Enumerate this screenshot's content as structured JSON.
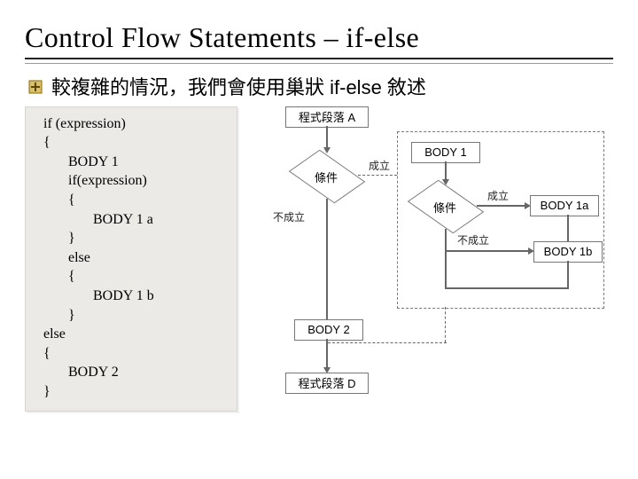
{
  "title": "Control Flow Statements – if-else",
  "bullet": "較複雜的情況，我們會使用巢狀 if-else 敘述",
  "code": {
    "l1": "if (expression)",
    "l2": "{",
    "l3": "BODY 1",
    "l4": "if(expression)",
    "l5": "{",
    "l6": "BODY 1 a",
    "l7": "}",
    "l8": "else",
    "l9": "{",
    "l10": "BODY 1 b",
    "l11": "}",
    "l12": "else",
    "l13": "{",
    "l14": "BODY 2",
    "l15": "}"
  },
  "flowchart": {
    "blockA": "程式段落 A",
    "cond1": "條件",
    "cond2": "條件",
    "trueLabel": "成立",
    "falseLabel": "不成立",
    "body1": "BODY 1",
    "body1a": "BODY 1a",
    "body1b": "BODY 1b",
    "body2": "BODY 2",
    "blockD": "程式段落 D"
  },
  "chart_data": {
    "type": "flowchart",
    "title": "巢狀 if-else 控制流程圖",
    "nodes": [
      {
        "id": "A",
        "kind": "process",
        "label": "程式段落 A"
      },
      {
        "id": "c1",
        "kind": "decision",
        "label": "條件"
      },
      {
        "id": "B1",
        "kind": "process",
        "label": "BODY 1"
      },
      {
        "id": "c2",
        "kind": "decision",
        "label": "條件"
      },
      {
        "id": "B1a",
        "kind": "process",
        "label": "BODY 1a"
      },
      {
        "id": "B1b",
        "kind": "process",
        "label": "BODY 1b"
      },
      {
        "id": "B2",
        "kind": "process",
        "label": "BODY 2"
      },
      {
        "id": "D",
        "kind": "process",
        "label": "程式段落 D"
      }
    ],
    "edges": [
      {
        "from": "A",
        "to": "c1",
        "label": ""
      },
      {
        "from": "c1",
        "to": "B1",
        "label": "成立"
      },
      {
        "from": "c1",
        "to": "B2",
        "label": "不成立"
      },
      {
        "from": "B1",
        "to": "c2",
        "label": ""
      },
      {
        "from": "c2",
        "to": "B1a",
        "label": "成立"
      },
      {
        "from": "c2",
        "to": "B1b",
        "label": "不成立"
      },
      {
        "from": "B1a",
        "to": "D",
        "label": ""
      },
      {
        "from": "B1b",
        "to": "D",
        "label": ""
      },
      {
        "from": "B2",
        "to": "D",
        "label": ""
      }
    ]
  }
}
